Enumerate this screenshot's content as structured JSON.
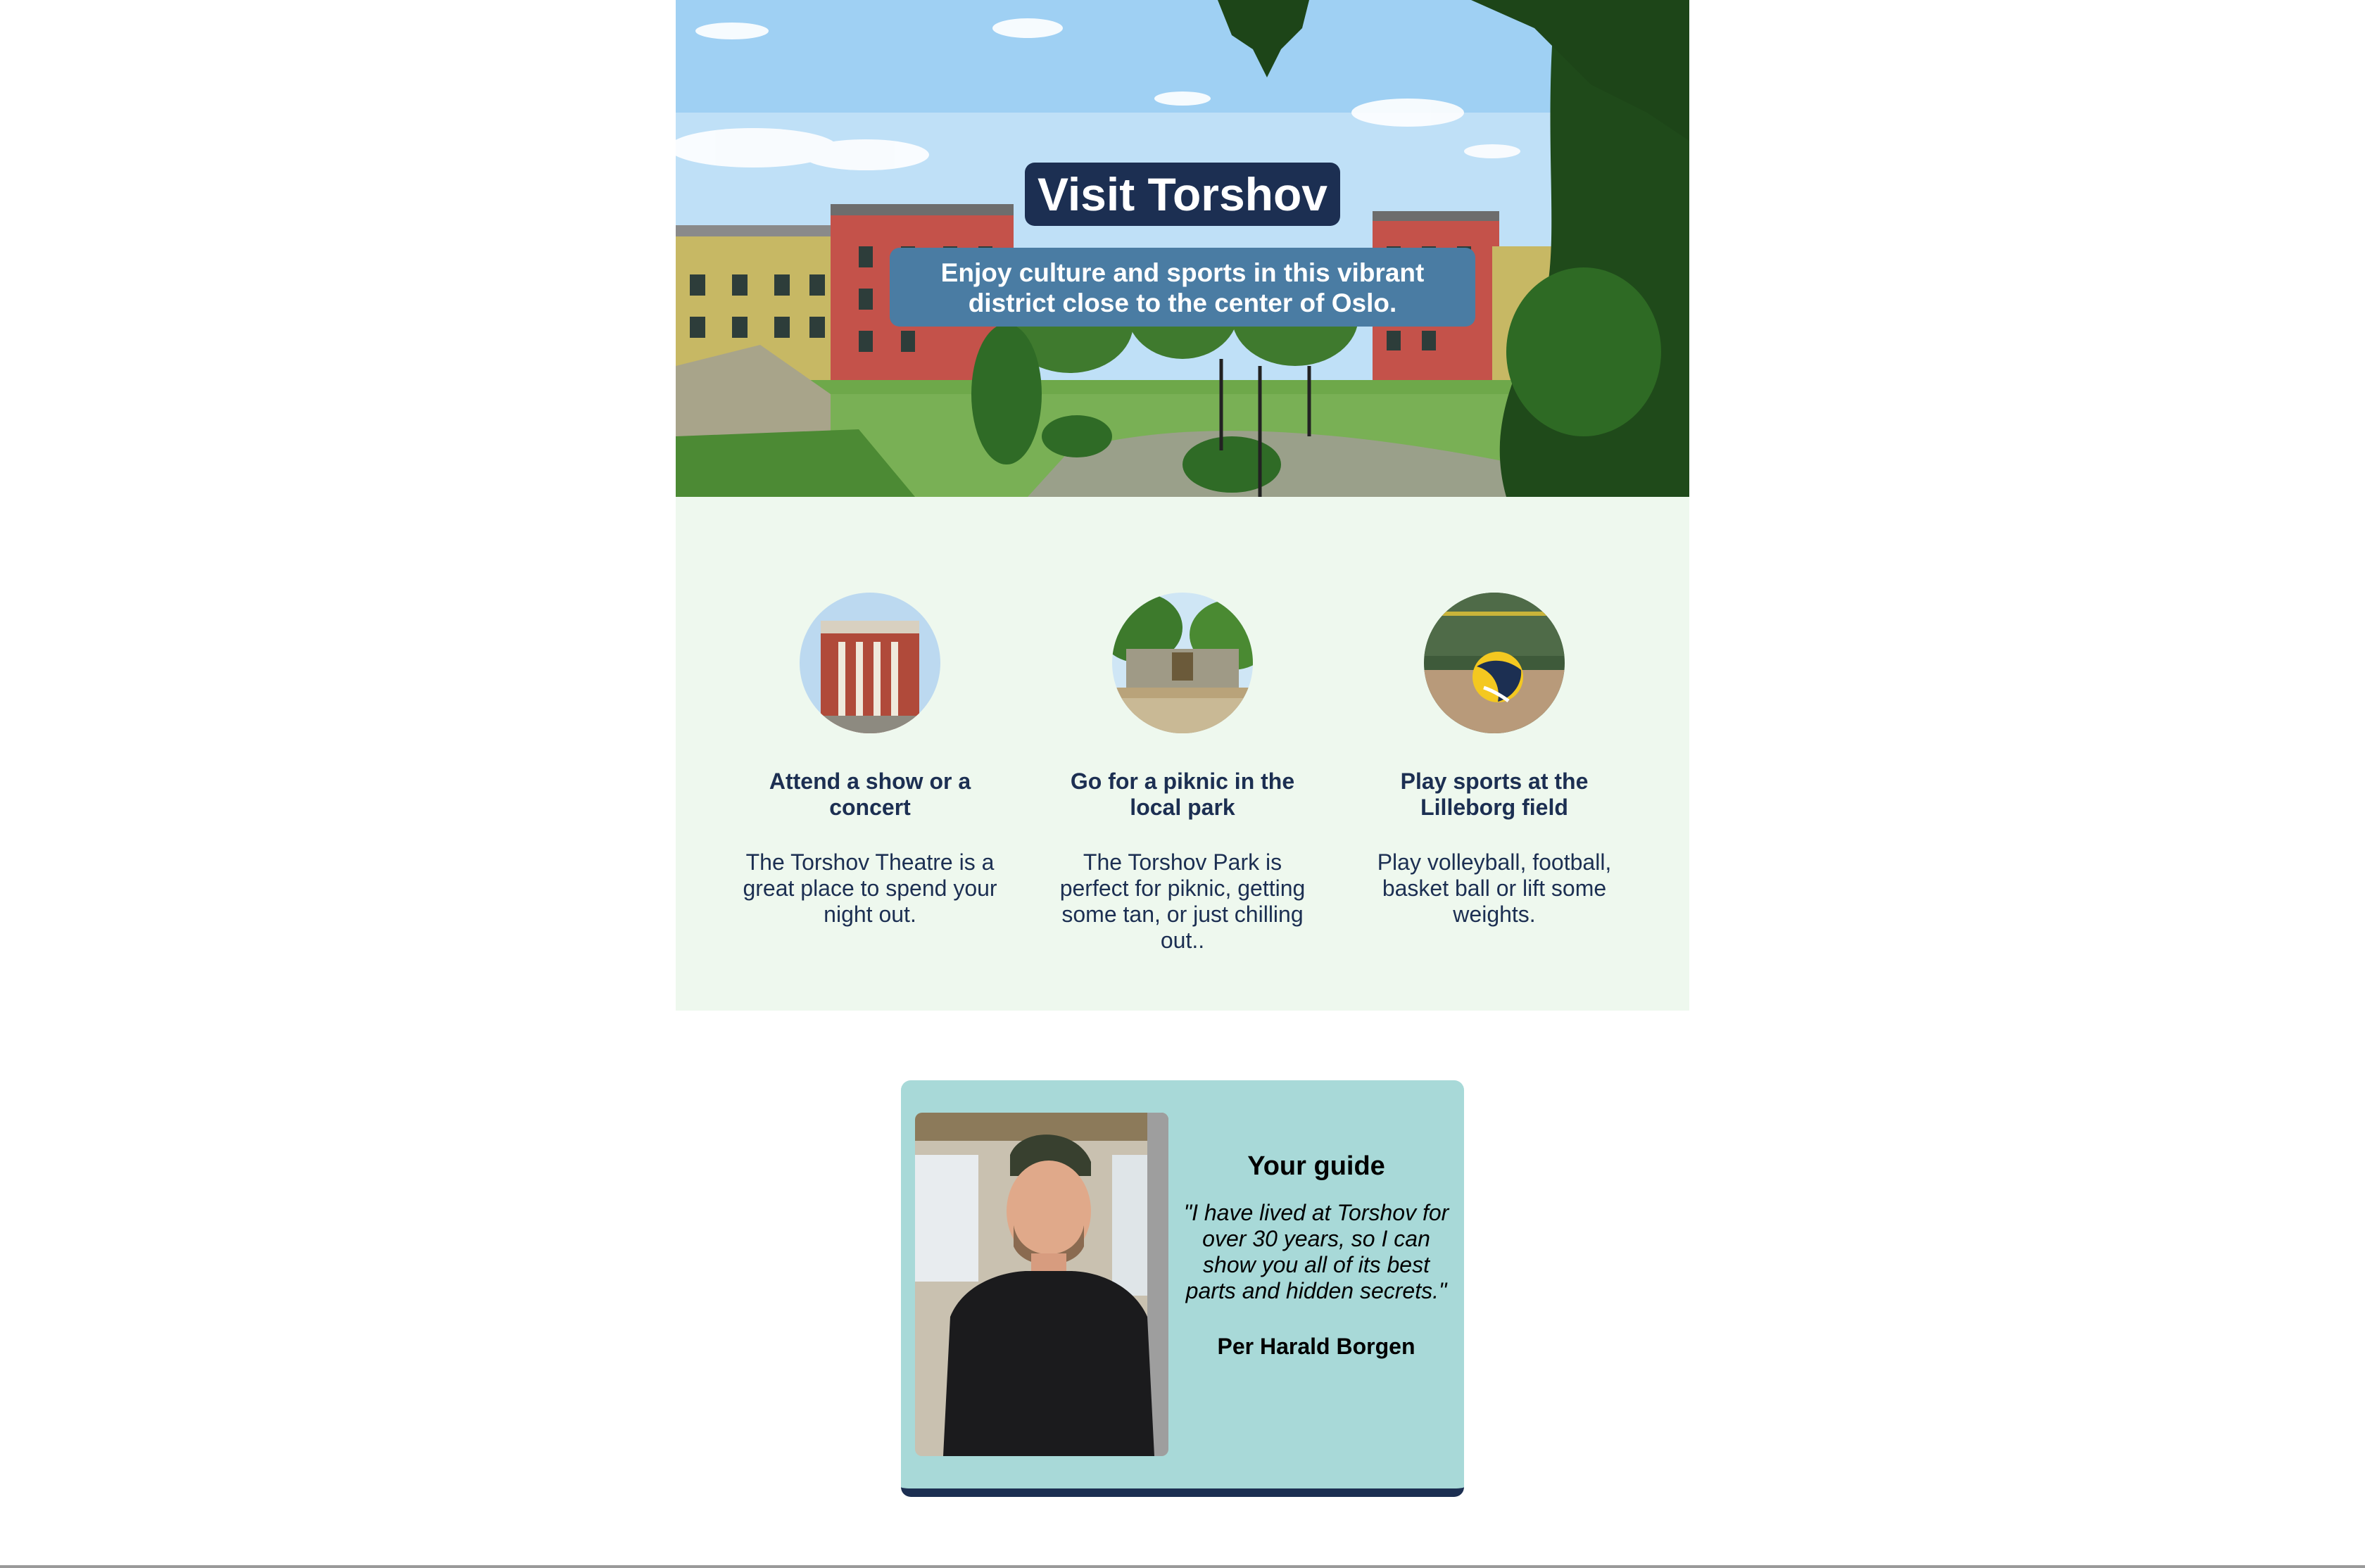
{
  "hero": {
    "title": "Visit Torshov",
    "subtitle": "Enjoy culture and sports in this vibrant district close to the center of Oslo."
  },
  "activities": [
    {
      "icon": "theatre-photo",
      "heading": "Attend a show or a concert",
      "text": "The Torshov Theatre is a great place to spend your night out."
    },
    {
      "icon": "park-photo",
      "heading": "Go for a piknic in the local park",
      "text": "The Torshov Park is perfect for piknic, getting some tan, or just chilling out.."
    },
    {
      "icon": "volleyball-photo",
      "heading": "Play sports at the Lilleborg field",
      "text": "Play volleyball, football, basket ball or lift some weights."
    }
  ],
  "guide": {
    "heading": "Your guide",
    "quote": "\"I have lived at Torshov for over 30 years, so I can show you all of its best parts and hidden secrets.\"",
    "name": "Per Harald Borgen"
  },
  "colors": {
    "navy": "#1c2f52",
    "subtitle_bg": "#4a7ca3",
    "activities_bg": "#eef8ee",
    "guide_bg": "#a8d9d8"
  }
}
